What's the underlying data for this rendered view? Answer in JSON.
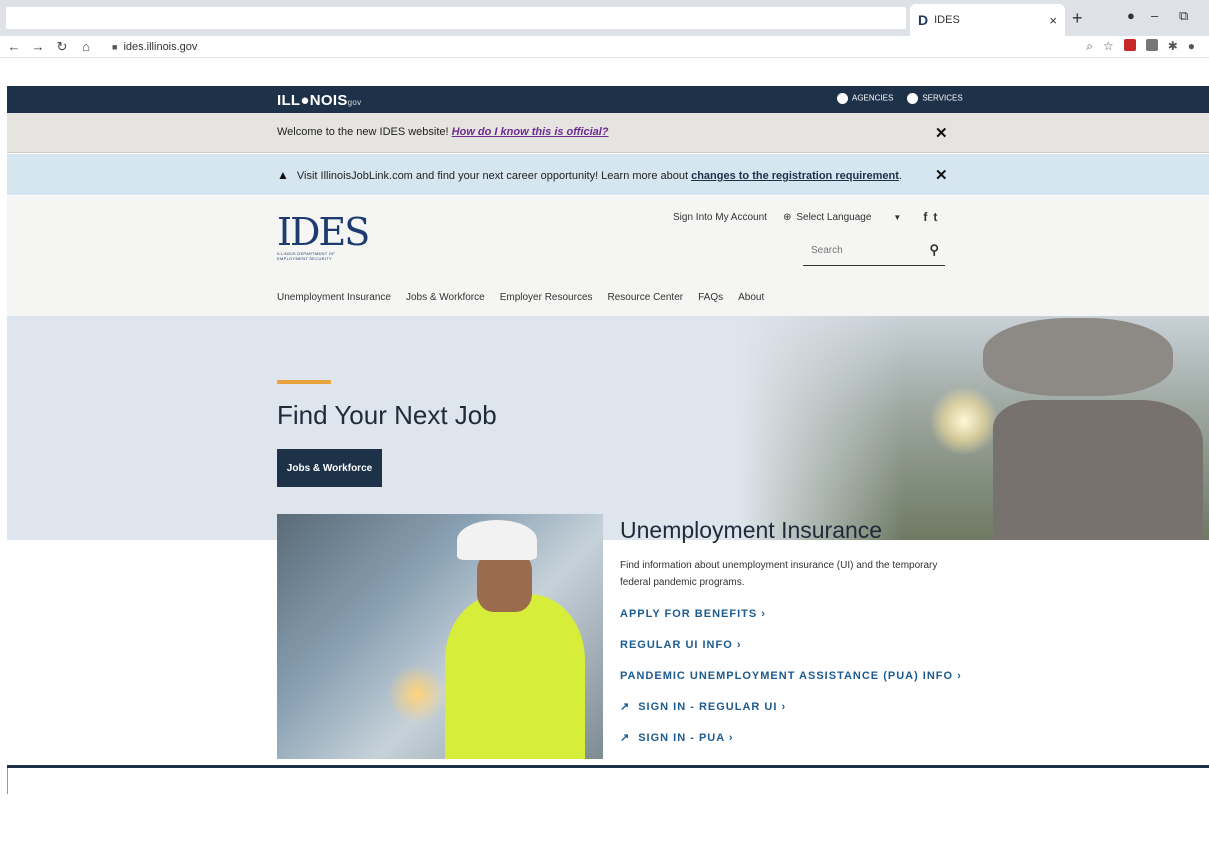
{
  "browser": {
    "tab_title": "IDES",
    "tab_favicon": "D",
    "url": "ides.illinois.gov",
    "new_tab": "+",
    "close_tab": "×",
    "minimize": "–",
    "restore": "⧉"
  },
  "illinois_bar": {
    "logo_main": "ILL●NOIS",
    "logo_suffix": "gov",
    "agencies": "AGENCIES",
    "services": "SERVICES"
  },
  "welcome_banner": {
    "text": "Welcome to the new IDES website! ",
    "link": "How do I know this is official?",
    "close": "✕"
  },
  "alert_banner": {
    "text": "Visit IllinoisJobLink.com and find your next career opportunity! Learn more about ",
    "link": "changes to the registration requirement",
    "trailing": ".",
    "close": "✕"
  },
  "header": {
    "logo_text": "IDES",
    "logo_subtext": "ILLINOIS DEPARTMENT OF EMPLOYMENT SECURITY",
    "sign_in": "Sign Into My Account",
    "select_language": "Select Language",
    "search_placeholder": "Search"
  },
  "nav": {
    "items": [
      "Unemployment Insurance",
      "Jobs & Workforce",
      "Employer Resources",
      "Resource Center",
      "FAQs",
      "About"
    ]
  },
  "hero": {
    "title": "Find Your Next Job",
    "button": "Jobs & Workforce"
  },
  "ui_section": {
    "title": "Unemployment Insurance",
    "description": "Find information about unemployment insurance (UI) and the temporary federal pandemic programs.",
    "links": [
      "APPLY FOR BENEFITS ›",
      "REGULAR UI INFO ›",
      "PANDEMIC UNEMPLOYMENT ASSISTANCE (PUA) INFO ›",
      "SIGN IN - REGULAR UI ›",
      "SIGN IN - PUA ›"
    ]
  }
}
